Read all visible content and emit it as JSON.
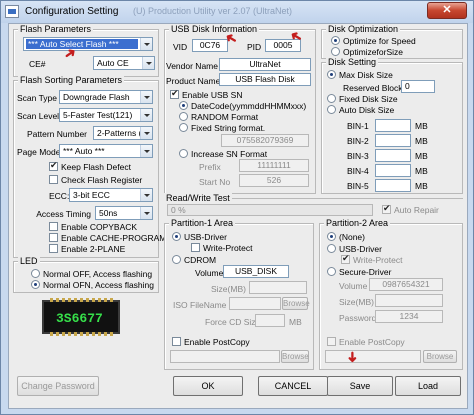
{
  "window": {
    "title": "Configuration Setting",
    "subtitle": "(U) Production Utility ver 2.07 (UltraNet)",
    "close_label": "✕"
  },
  "flash_params": {
    "title": "Flash Parameters",
    "flash_value": "*** Auto Select Flash ***",
    "ce_label": "CE#",
    "ce_value": "Auto CE"
  },
  "sorting": {
    "title": "Flash Sorting Parameters",
    "scan_type_label": "Scan Type",
    "scan_type": "Downgrade Flash",
    "scan_level_label": "Scan Level",
    "scan_level": "5-Faster Test(121)",
    "pattern_label": "Pattern Number",
    "pattern": "2-Patterns (*)",
    "page_mode_label": "Page Mode",
    "page_mode": "*** Auto ***",
    "keep_defect": "Keep Flash Defect",
    "check_register": "Check Flash Register",
    "ecc_label": "ECC:",
    "ecc": "3-bit ECC",
    "access_timing_label": "Access Timing",
    "access_timing": "50ns",
    "copyback": "Enable COPYBACK",
    "cache_program": "Enable CACHE-PROGRAM",
    "two_plane": "Enable 2-PLANE"
  },
  "led": {
    "title": "LED",
    "normal_off": "Normal OFF, Access flashing",
    "normal_on": "Normal OFN, Access flashing"
  },
  "chip_label": "3S6677",
  "usb_info": {
    "title": "USB Disk Information",
    "vid_label": "VID",
    "vid": "0C76",
    "pid_label": "PID",
    "pid": "0005",
    "vendor_label": "Vendor Name",
    "vendor": "UltraNet",
    "product_label": "Product Name",
    "product": "USB Flash Disk",
    "enable_sn": "Enable USB SN",
    "datecode": "DateCode(yymmddHHMMxxx)",
    "random": "RANDOM Format",
    "fixed": "Fixed String format.",
    "fixed_value": "075582079369",
    "increase": "Increase SN Format",
    "prefix_label": "Prefix",
    "prefix": "11111111",
    "start_label": "Start No",
    "start": "526"
  },
  "disk_opt": {
    "title": "Disk Optimization",
    "speed": "Optimize for Speed",
    "size": "OptimizeforSize"
  },
  "disk_setting": {
    "title": "Disk Setting",
    "max_size": "Max Disk Size",
    "reserved_label": "Reserved Block",
    "reserved": "0",
    "fixed_size": "Fixed Disk Size",
    "auto_size": "Auto Disk Size",
    "bins": [
      {
        "label": "BIN-1",
        "unit": "MB"
      },
      {
        "label": "BIN-2",
        "unit": "MB"
      },
      {
        "label": "BIN-3",
        "unit": "MB"
      },
      {
        "label": "BIN-4",
        "unit": "MB"
      },
      {
        "label": "BIN-5",
        "unit": "MB"
      }
    ]
  },
  "rw_test": {
    "title": "Read/Write Test",
    "progress_text": "0 %",
    "progress": 0,
    "auto_repair": "Auto Repair"
  },
  "p1": {
    "title": "Partition-1 Area",
    "usb_driver": "USB-Driver",
    "write_protect": "Write-Protect",
    "cdrom": "CDROM",
    "volume_label": "Volume",
    "volume": "USB_DISK",
    "size_label": "Size(MB)",
    "iso_label": "ISO FileName",
    "browse": "Browse",
    "force_cd_label": "Force CD Size",
    "mb": "MB",
    "postcopy": "Enable PostCopy",
    "browse2": "Browse"
  },
  "p2": {
    "title": "Partition-2 Area",
    "none": "(None)",
    "usb_driver": "USB-Driver",
    "write_protect": "Write-Protect",
    "secure": "Secure-Driver",
    "volume_label": "Volume",
    "volume": "0987654321",
    "size_label": "Size(MB)",
    "password_label": "Password",
    "password": "1234",
    "postcopy": "Enable PostCopy",
    "browse": "Browse"
  },
  "buttons": {
    "change_password": "Change Password",
    "ok": "OK",
    "cancel": "CANCEL",
    "save": "Save",
    "load": "Load"
  },
  "colors": {
    "selection": "#3b6ecf",
    "arrow": "#c41e1e",
    "chip_text": "#36e04a"
  }
}
